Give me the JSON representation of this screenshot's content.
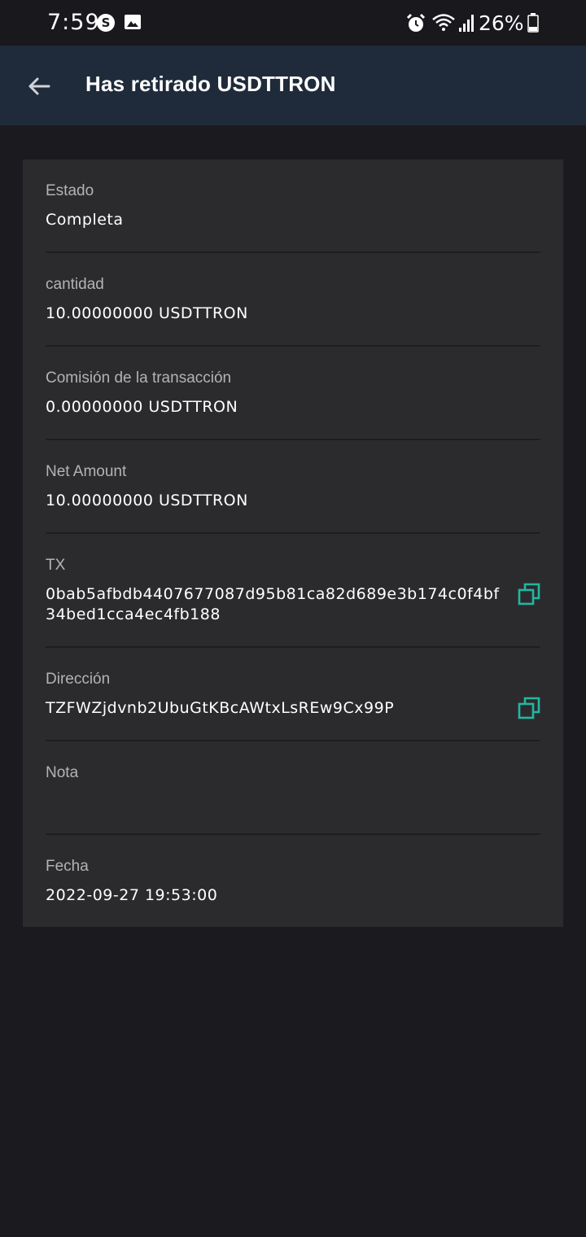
{
  "status_bar": {
    "time": "7:59",
    "battery_percent": "26%",
    "icons": [
      "skype-icon",
      "image-icon",
      "alarm-icon",
      "wifi-icon",
      "signal-icon",
      "battery-icon"
    ]
  },
  "app_bar": {
    "title": "Has retirado USDTTRON",
    "back_icon": "arrow-left-icon"
  },
  "details": {
    "estado": {
      "label": "Estado",
      "value": "Completa"
    },
    "cantidad": {
      "label": "cantidad",
      "value": "10.00000000 USDTTRON"
    },
    "comision": {
      "label": "Comisión de la transacción",
      "value": "0.00000000 USDTTRON"
    },
    "net_amount": {
      "label": "Net Amount",
      "value": "10.00000000 USDTTRON"
    },
    "tx": {
      "label": "TX",
      "value": "0bab5afbdb4407677087d95b81ca82d689e3b174c0f4bf34bed1cca4ec4fb188"
    },
    "direccion": {
      "label": "Dirección",
      "value": "TZFWZjdvnb2UbuGtKBcAWtxLsREw9Cx99P"
    },
    "nota": {
      "label": "Nota",
      "value": ""
    },
    "fecha": {
      "label": "Fecha",
      "value": "2022-09-27 19:53:00"
    }
  },
  "colors": {
    "background": "#1b1a1f",
    "app_bar": "#1f2b3a",
    "card": "#2b2b2e",
    "accent_copy": "#22b7a0",
    "label": "#b3b3b6"
  }
}
